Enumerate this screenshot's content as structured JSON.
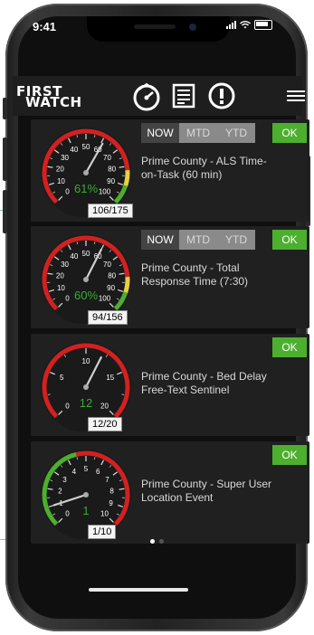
{
  "status_bar": {
    "time": "9:41"
  },
  "header": {
    "logo_line1": "FIRST",
    "logo_line2": "WATCH",
    "icons": [
      "speedometer-icon",
      "report-icon",
      "alert-icon",
      "menu-icon"
    ]
  },
  "cards": [
    {
      "title": "Prime County - ALS Time-on-Task (60 min)",
      "percent": "61%",
      "count": "106/175",
      "gauge_fraction": 0.61,
      "has_period_tabs": true,
      "ok_label": "OK",
      "gauge_color": "#3aaa35"
    },
    {
      "title": "Prime County - Total Response Time (7:30)",
      "percent": "60%",
      "count": "94/156",
      "gauge_fraction": 0.6,
      "has_period_tabs": true,
      "ok_label": "OK",
      "gauge_color": "#3aaa35"
    },
    {
      "title": "Prime County - Bed Delay Free-Text Sentinel",
      "percent": "12",
      "count": "12/20",
      "gauge_fraction": 0.6,
      "has_period_tabs": false,
      "ok_label": "OK",
      "gauge_color": "#3aaa35"
    },
    {
      "title": "Prime County - Super User Location Event",
      "percent": "1",
      "count": "1/10",
      "gauge_fraction": 0.1,
      "has_period_tabs": false,
      "ok_label": "OK",
      "gauge_color": "#3aaa35"
    }
  ],
  "tabs": {
    "now": "NOW",
    "mtd": "MTD",
    "ytd": "YTD"
  },
  "gauge_scales": {
    "percent": [
      "0",
      "10",
      "20",
      "30",
      "40",
      "50",
      "60",
      "70",
      "80",
      "90",
      "100"
    ],
    "twenty": [
      "0",
      "5",
      "10",
      "15",
      "20"
    ],
    "ten": [
      "0",
      "1",
      "2",
      "3",
      "4",
      "5",
      "6",
      "7",
      "8",
      "9",
      "10"
    ]
  },
  "pagination": {
    "pages": 2,
    "current": 1
  }
}
